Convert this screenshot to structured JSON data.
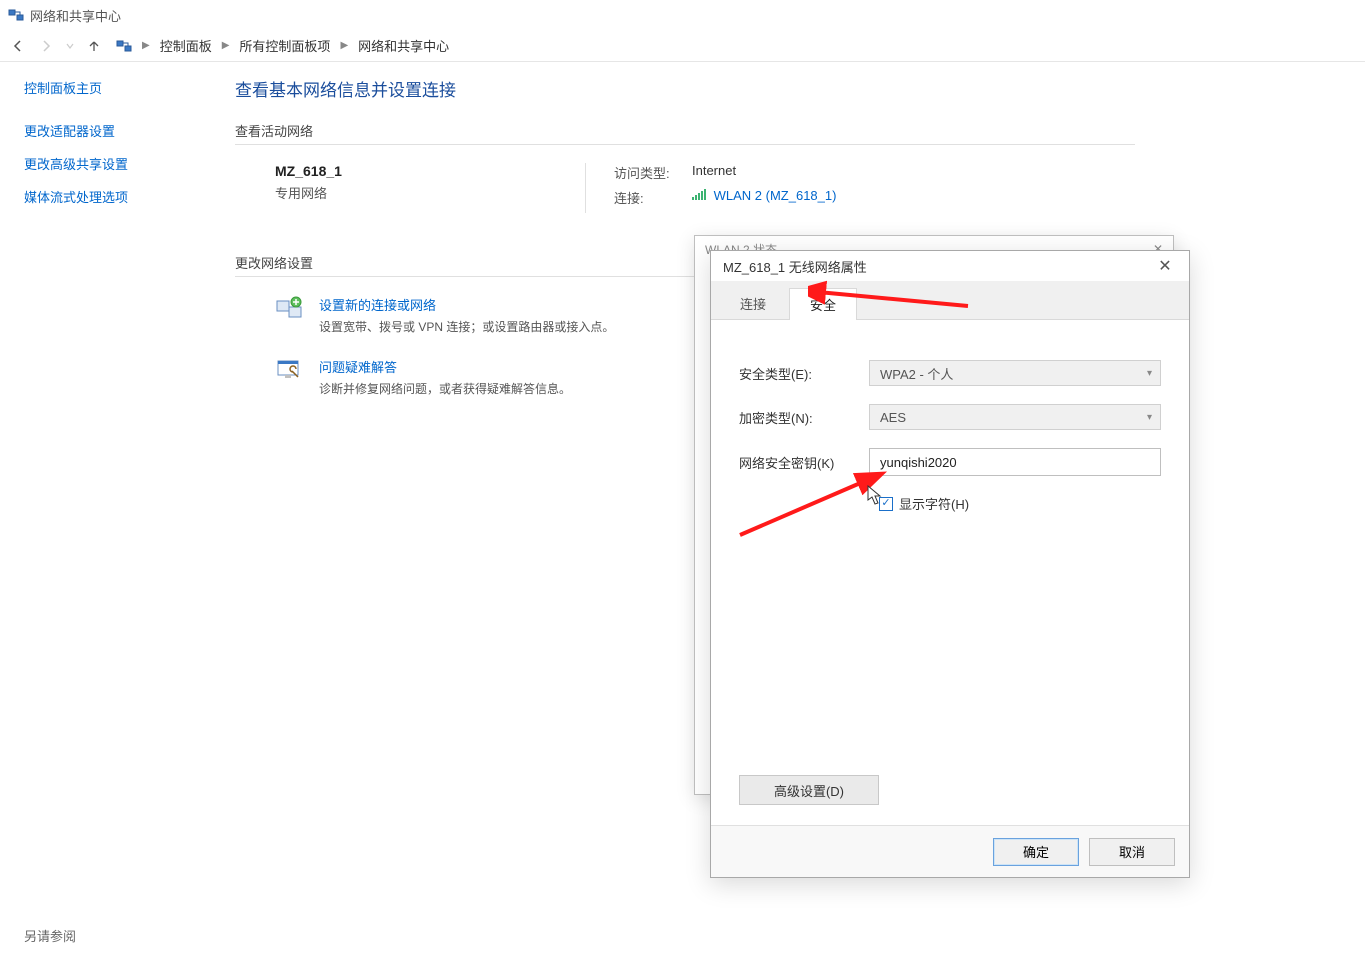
{
  "titlebar": {
    "icon_name": "network-share-icon",
    "title": "网络和共享中心"
  },
  "nav": {
    "back_enabled": true,
    "forward_enabled": false,
    "breadcrumb": [
      "控制面板",
      "所有控制面板项",
      "网络和共享中心"
    ]
  },
  "sidebar": {
    "home": "控制面板主页",
    "links": [
      "更改适配器设置",
      "更改高级共享设置",
      "媒体流式处理选项"
    ]
  },
  "page": {
    "title": "查看基本网络信息并设置连接",
    "active_networks_header": "查看活动网络",
    "change_settings_header": "更改网络设置",
    "network": {
      "name": "MZ_618_1",
      "type": "专用网络",
      "access_label": "访问类型:",
      "access_value": "Internet",
      "connect_label": "连接:",
      "connect_value": "WLAN 2 (MZ_618_1)"
    },
    "tasks": [
      {
        "icon": "new-connection-icon",
        "title": "设置新的连接或网络",
        "desc": "设置宽带、拨号或 VPN 连接；或设置路由器或接入点。"
      },
      {
        "icon": "troubleshoot-icon",
        "title": "问题疑难解答",
        "desc": "诊断并修复网络问题，或者获得疑难解答信息。"
      }
    ]
  },
  "dialog_back": {
    "title": "WLAN 2 状态"
  },
  "dialog": {
    "title": "MZ_618_1 无线网络属性",
    "tabs": {
      "connect": "连接",
      "security": "安全"
    },
    "security": {
      "type_label": "安全类型(E):",
      "type_value": "WPA2 - 个人",
      "enc_label": "加密类型(N):",
      "enc_value": "AES",
      "key_label": "网络安全密钥(K)",
      "key_value": "yunqishi2020",
      "showchars_label": "显示字符(H)",
      "showchars_checked": true,
      "advanced_btn": "高级设置(D)"
    },
    "buttons": {
      "ok": "确定",
      "cancel": "取消"
    }
  },
  "see_also": "另请参阅"
}
